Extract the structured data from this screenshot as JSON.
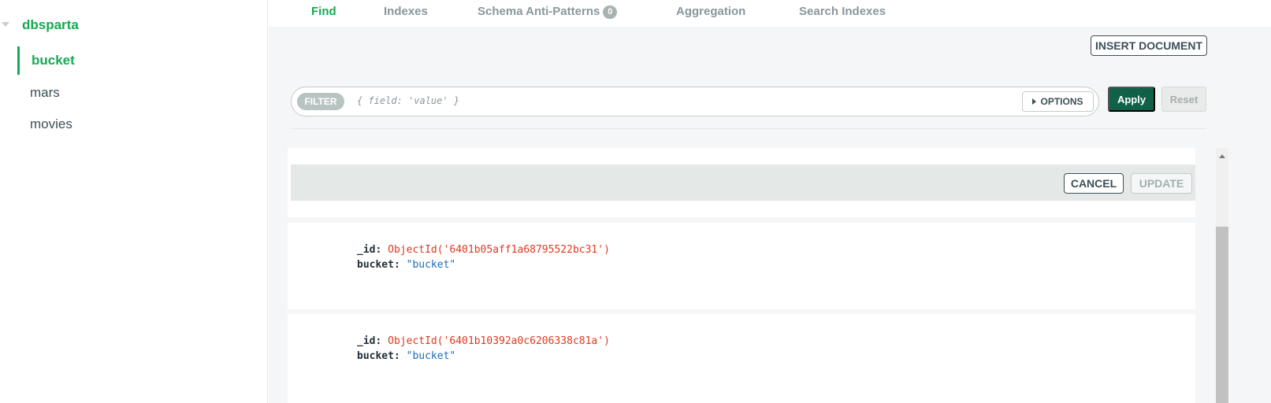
{
  "sidebar": {
    "database": "dbsparta",
    "collections": [
      {
        "label": "bucket",
        "active": true
      },
      {
        "label": "mars",
        "active": false
      },
      {
        "label": "movies",
        "active": false
      }
    ]
  },
  "tabs": [
    {
      "label": "Find",
      "active": true
    },
    {
      "label": "Indexes",
      "active": false
    },
    {
      "label": "Schema Anti-Patterns",
      "badge": "0",
      "active": false
    },
    {
      "label": "Aggregation",
      "active": false
    },
    {
      "label": "Search Indexes",
      "active": false
    }
  ],
  "toolbar": {
    "insert_label": "INSERT DOCUMENT"
  },
  "filter": {
    "label": "FILTER",
    "placeholder": "{ field: 'value' }",
    "options_label": "OPTIONS",
    "apply_label": "Apply",
    "reset_label": "Reset"
  },
  "edit": {
    "cancel_label": "CANCEL",
    "update_label": "UPDATE"
  },
  "documents": [
    {
      "id_key": "_id:",
      "id_value": "ObjectId('6401b05aff1a68795522bc31')",
      "field_key": "bucket:",
      "field_value": "\"bucket\""
    },
    {
      "id_key": "_id:",
      "id_value": "ObjectId('6401b10392a0c6206338c81a')",
      "field_key": "bucket:",
      "field_value": "\"bucket\""
    }
  ],
  "colors": {
    "accent_green": "#13aa52",
    "apply_green": "#116149",
    "objectid_red": "#e0391f",
    "string_blue": "#1b6db6"
  }
}
